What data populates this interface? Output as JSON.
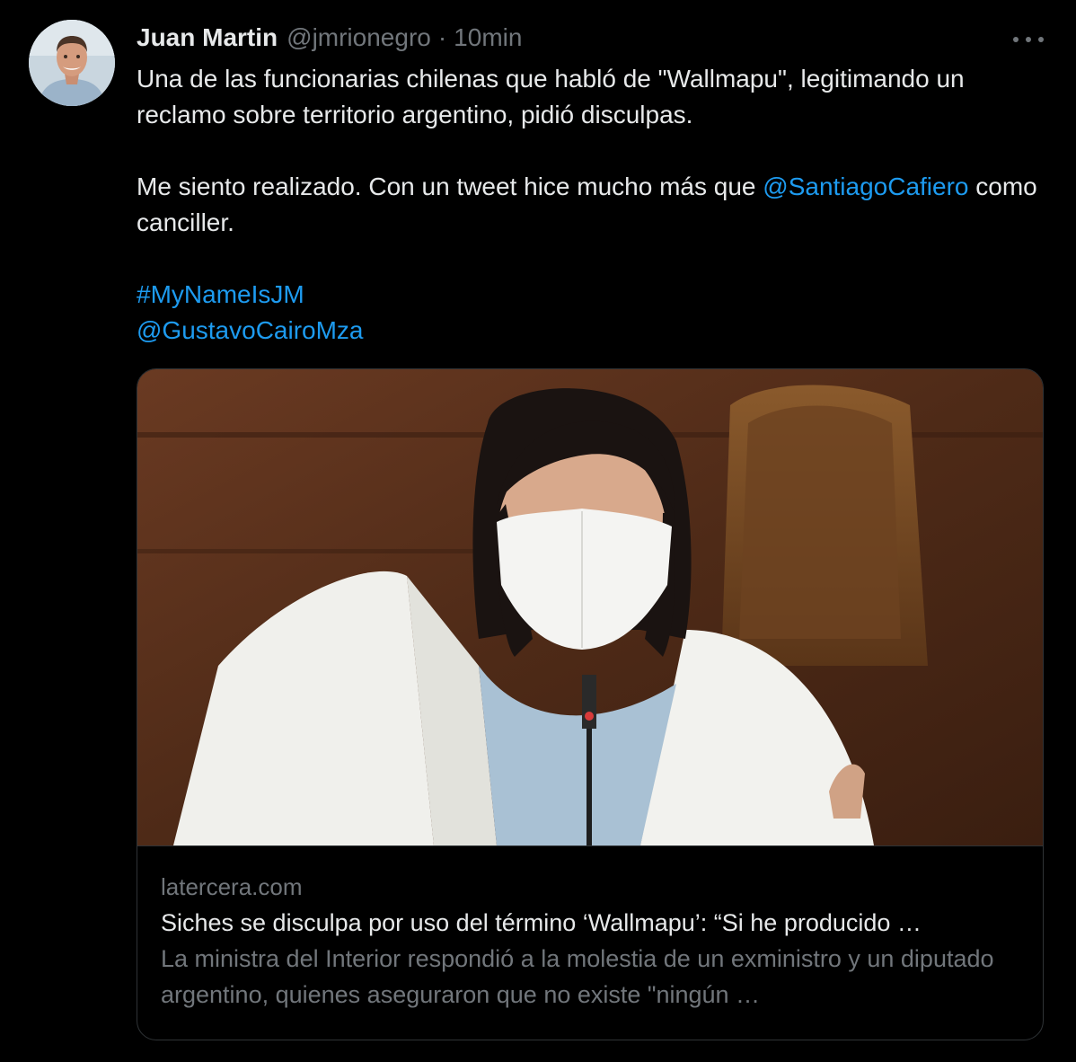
{
  "author": {
    "name": "Juan Martin",
    "handle": "@jmrionegro",
    "separator": "·",
    "time": "10min"
  },
  "tweet": {
    "line1_text": "Una de las funcionarias chilenas que habló de \"Wallmapu\", legitimando un reclamo sobre territorio argentino, pidió disculpas.",
    "line2_before": "Me siento realizado. Con un tweet hice mucho más que ",
    "line2_mention": "@SantiagoCafiero",
    "line2_after": " como canciller.",
    "hashtag": "#MyNameIsJM",
    "mention": "@GustavoCairoMza"
  },
  "card": {
    "domain": "latercera.com",
    "title": "Siches se disculpa por uso del término ‘Wallmapu’: “Si he producido …",
    "description": "La ministra del Interior respondió a la molestia de un exministro y un diputado argentino, quienes aseguraron que no existe \"ningún …"
  },
  "icons": {
    "more": "more-options-icon",
    "avatar": "profile-photo"
  },
  "colors": {
    "background": "#000000",
    "text": "#e7e9ea",
    "secondary": "#71767b",
    "link": "#1d9bf0",
    "border": "#2f3336"
  }
}
